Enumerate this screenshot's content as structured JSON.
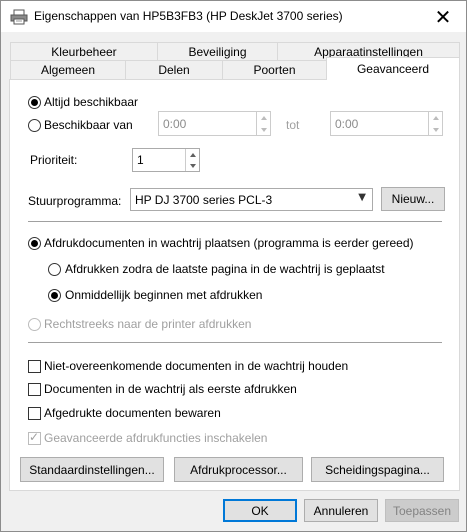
{
  "window": {
    "title": "Eigenschappen van HP5B3FB3 (HP DeskJet 3700 series)"
  },
  "tabs": {
    "row1": [
      "Kleurbeheer",
      "Beveiliging",
      "Apparaatinstellingen"
    ],
    "row2": [
      "Algemeen",
      "Delen",
      "Poorten",
      "Geavanceerd"
    ],
    "active": "Geavanceerd"
  },
  "availability": {
    "always_label": "Altijd beschikbaar",
    "from_label": "Beschikbaar van",
    "from_value": "0:00",
    "to_label": "tot",
    "to_value": "0:00",
    "selected": "always"
  },
  "priority": {
    "label": "Prioriteit:",
    "value": "1"
  },
  "driver": {
    "label": "Stuurprogramma:",
    "value": "HP DJ 3700 series PCL-3",
    "new_button": "Nieuw..."
  },
  "spool": {
    "spool_label": "Afdrukdocumenten in wachtrij plaatsen (programma is eerder gereed)",
    "after_last_label": "Afdrukken zodra de laatste pagina in de wachtrij is geplaatst",
    "immediately_label": "Onmiddellijk beginnen met afdrukken",
    "direct_label": "Rechtstreeks naar de printer afdrukken",
    "selected": "spool",
    "sub_selected": "immediately"
  },
  "options": {
    "hold_mismatched": "Niet-overeenkomende documenten in de wachtrij houden",
    "spooled_first": "Documenten in de wachtrij als eerste afdrukken",
    "keep_printed": "Afgedrukte documenten bewaren",
    "advanced_features": "Geavanceerde afdrukfuncties inschakelen",
    "hold_mismatched_checked": false,
    "spooled_first_checked": false,
    "keep_printed_checked": false,
    "advanced_features_checked": true
  },
  "panel_buttons": {
    "defaults": "Standaardinstellingen...",
    "processor": "Afdrukprocessor...",
    "separator": "Scheidingspagina..."
  },
  "dialog_buttons": {
    "ok": "OK",
    "cancel": "Annuleren",
    "apply": "Toepassen"
  },
  "colors": {
    "accent": "#0078d7",
    "window_bg": "#f0f0f0",
    "panel_bg": "#ffffff",
    "disabled_text": "#a0a0a0"
  },
  "icons": {
    "title": "printer-icon",
    "close": "close-icon",
    "dropdown": "chevron-down-icon",
    "spin_up": "arrow-up-icon",
    "spin_down": "arrow-down-icon"
  }
}
